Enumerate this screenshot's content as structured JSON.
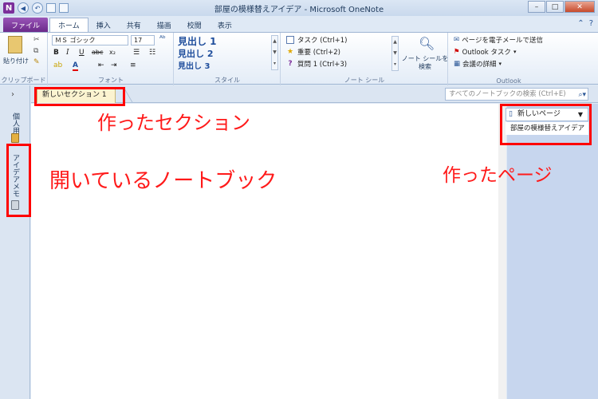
{
  "window": {
    "title": "部屋の模様替えアイデア - Microsoft OneNote",
    "app_icon": "N"
  },
  "ribbon_tabs": [
    "ファイル",
    "ホーム",
    "挿入",
    "共有",
    "描画",
    "校閲",
    "表示"
  ],
  "ribbon": {
    "clipboard": {
      "paste_label": "貼り付け",
      "group_label": "クリップボード"
    },
    "font": {
      "font_name": "ＭＳ ゴシック",
      "font_size": "17",
      "group_label": "フォント"
    },
    "styles": {
      "heading1": "見出し 1",
      "heading2": "見出し 2",
      "heading3": "見出し 3",
      "group_label": "スタイル"
    },
    "tags": {
      "items": [
        "タスク (Ctrl+1)",
        "重要 (Ctrl+2)",
        "質問 1 (Ctrl+3)"
      ],
      "find_tags_label_1": "ノート シールを",
      "find_tags_label_2": "検索",
      "group_label": "ノート シール"
    },
    "outlook": {
      "items": [
        "ページを電子メールで送信",
        "Outlook タスク",
        "会議の詳細"
      ],
      "group_label": "Outlook"
    }
  },
  "notebooks": {
    "collapse_glyph": "›",
    "personal": "個人用",
    "open_notebook": "アイデアメモ"
  },
  "section": {
    "active_tab": "新しいセクション 1",
    "search_placeholder": "すべてのノートブックの検索 (Ctrl+E)"
  },
  "pages": {
    "new_page_label": "新しいページ",
    "entries": [
      "部屋の模様替えアイデア"
    ]
  },
  "annotations": {
    "section": "作ったセクション",
    "notebook": "開いているノートブック",
    "page": "作ったページ"
  },
  "colors": {
    "annotation": "#ff0000",
    "section_tab": "#fbf3d0",
    "page_pane": "#c7d6ee"
  }
}
